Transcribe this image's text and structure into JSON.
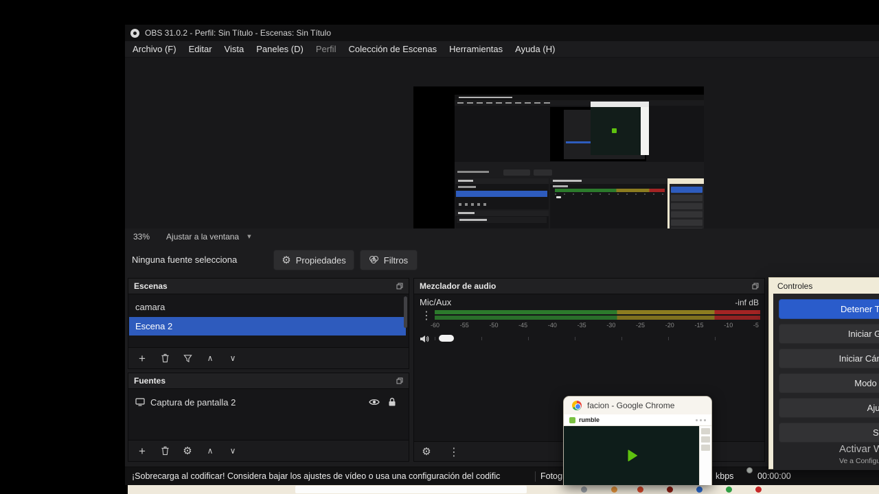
{
  "titlebar": {
    "title": "OBS 31.0.2 - Perfil: Sin Título - Escenas: Sin Título"
  },
  "menubar": {
    "items": [
      "Archivo (F)",
      "Editar",
      "Vista",
      "Paneles (D)",
      "Perfil",
      "Colección de Escenas",
      "Herramientas",
      "Ayuda (H)"
    ]
  },
  "preview": {
    "zoom": "33%",
    "fit": "Ajustar a la ventana"
  },
  "source_toolbar": {
    "no_source": "Ninguna fuente selecciona",
    "properties": "Propiedades",
    "filters": "Filtros"
  },
  "scenes": {
    "title": "Escenas",
    "items": [
      {
        "name": "camara"
      },
      {
        "name": "Escena 2"
      }
    ]
  },
  "sources": {
    "title": "Fuentes",
    "items": [
      {
        "name": "Captura de pantalla 2"
      }
    ]
  },
  "mixer": {
    "title": "Mezclador de audio",
    "channel": "Mic/Aux",
    "level": "-inf dB",
    "scale": [
      "-60",
      "-55",
      "-50",
      "-45",
      "-40",
      "-35",
      "-30",
      "-25",
      "-20",
      "-15",
      "-10",
      "-5"
    ]
  },
  "controls": {
    "title": "Controles",
    "buttons": [
      "Detener Transmisión",
      "Iniciar Grabación",
      "Iniciar Cámara Virtual",
      "Modo Estudio",
      "Ajustes",
      "Salir"
    ]
  },
  "watermark": {
    "line1": "Activar Windows",
    "line2": "Ve a Configuración para activar Windows"
  },
  "status_bar": {
    "warning": "¡Sobrecarga al codificar! Considera bajar los ajustes de vídeo o usa una configuración del codific",
    "frames": "Fotogramas",
    "bitrate": "kbps",
    "time": "00:00:00"
  },
  "chrome_window": {
    "title": "facion - Google Chrome",
    "site": "rumble"
  },
  "icons": {
    "plus": "+",
    "up": "∧",
    "down": "∨",
    "dots": "⋮",
    "gear": "⚙",
    "caret": "▾"
  },
  "colors": {
    "selection": "#2e5bbd",
    "meter_green": "#2c7a2c",
    "meter_yellow": "#8c7c20",
    "meter_red": "#a32424",
    "controls_bg": "#f0ebd8",
    "rumble_green": "#5ec10f"
  }
}
